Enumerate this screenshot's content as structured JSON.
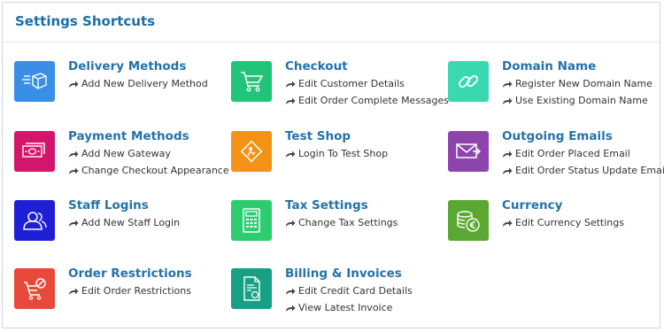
{
  "panel": {
    "title": "Settings Shortcuts"
  },
  "items": [
    {
      "title": "Delivery Methods",
      "icon": "delivery-truck-icon",
      "color": "#3a8ee6",
      "links": [
        "Add New Delivery Method"
      ]
    },
    {
      "title": "Checkout",
      "icon": "shopping-cart-icon",
      "color": "#22c47a",
      "links": [
        "Edit Customer Details",
        "Edit Order Complete Messages"
      ]
    },
    {
      "title": "Domain Name",
      "icon": "chain-link-icon",
      "color": "#3ad8b0",
      "links": [
        "Register New Domain Name",
        "Use Existing Domain Name"
      ]
    },
    {
      "title": "Payment Methods",
      "icon": "cash-icon",
      "color": "#d3166c",
      "links": [
        "Add New Gateway",
        "Change Checkout Appearance"
      ]
    },
    {
      "title": "Test Shop",
      "icon": "test-shop-icon",
      "color": "#f39214",
      "links": [
        "Login To Test Shop"
      ]
    },
    {
      "title": "Outgoing Emails",
      "icon": "envelope-icon",
      "color": "#8e44ad",
      "links": [
        "Edit Order Placed Email",
        "Edit Order Status Update Email"
      ]
    },
    {
      "title": "Staff Logins",
      "icon": "users-icon",
      "color": "#1f1fd6",
      "links": [
        "Add New Staff Login"
      ]
    },
    {
      "title": "Tax Settings",
      "icon": "calculator-icon",
      "color": "#2ecc71",
      "links": [
        "Change Tax Settings"
      ]
    },
    {
      "title": "Currency",
      "icon": "coins-icon",
      "color": "#5aa832",
      "links": [
        "Edit Currency Settings"
      ]
    },
    {
      "title": "Order Restrictions",
      "icon": "restricted-cart-icon",
      "color": "#e8493a",
      "links": [
        "Edit Order Restrictions"
      ]
    },
    {
      "title": "Billing & Invoices",
      "icon": "invoice-icon",
      "color": "#16a085",
      "links": [
        "Edit Credit Card Details",
        "View Latest Invoice"
      ]
    }
  ]
}
